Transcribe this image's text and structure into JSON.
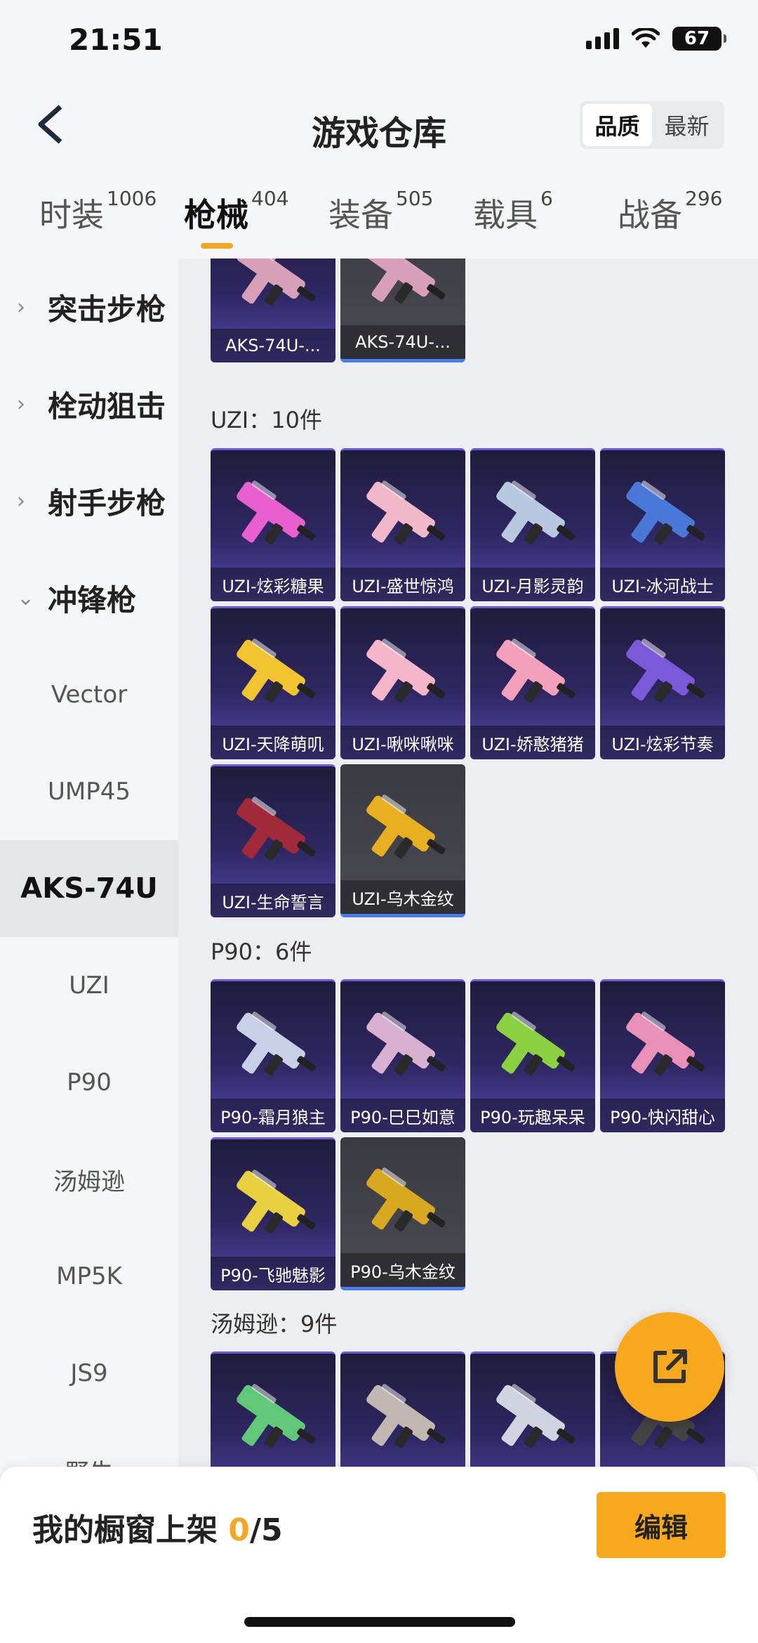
{
  "status_bar": {
    "time": "21:51",
    "battery": "67"
  },
  "header": {
    "title": "游戏仓库",
    "sort_options": [
      "品质",
      "最新"
    ],
    "active_sort": "品质"
  },
  "category_tabs": [
    {
      "label": "时装",
      "count": "1006"
    },
    {
      "label": "枪械",
      "count": "404",
      "active": true
    },
    {
      "label": "装备",
      "count": "505"
    },
    {
      "label": "载具",
      "count": "6"
    },
    {
      "label": "战备",
      "count": "296"
    }
  ],
  "sidebar": {
    "groups": [
      "突击步枪",
      "栓动狙击",
      "射手步枪",
      "冲锋枪"
    ],
    "items": [
      "Vector",
      "UMP45",
      "AKS-74U",
      "UZI",
      "P90",
      "汤姆逊",
      "MP5K",
      "JS9",
      "野牛"
    ],
    "active_item": "AKS-74U"
  },
  "sections": {
    "aks": {
      "cards": [
        {
          "label": "AKS-74U-...",
          "style": "purple"
        },
        {
          "label": "AKS-74U-...",
          "style": "gray"
        }
      ]
    },
    "uzi": {
      "title": "UZI：10件",
      "cards": [
        {
          "label": "UZI-炫彩糖果",
          "style": "purple",
          "color": "#e85fd0"
        },
        {
          "label": "UZI-盛世惊鸿",
          "style": "purple",
          "color": "#f0b8c8"
        },
        {
          "label": "UZI-月影灵韵",
          "style": "purple",
          "color": "#b8c8e0"
        },
        {
          "label": "UZI-冰河战士",
          "style": "purple",
          "color": "#4a78d8"
        },
        {
          "label": "UZI-天降萌叽",
          "style": "purple",
          "color": "#f2c430"
        },
        {
          "label": "UZI-啾咪啾咪",
          "style": "purple",
          "color": "#f4b6c8"
        },
        {
          "label": "UZI-娇憨猪猪",
          "style": "purple",
          "color": "#f2a0bc"
        },
        {
          "label": "UZI-炫彩节奏",
          "style": "purple",
          "color": "#7a5ad8"
        },
        {
          "label": "UZI-生命誓言",
          "style": "purple",
          "color": "#a02a3a"
        },
        {
          "label": "UZI-乌木金纹",
          "style": "gray",
          "color": "#e8b020"
        }
      ]
    },
    "p90": {
      "title": "P90：6件",
      "cards": [
        {
          "label": "P90-霜月狼主",
          "style": "purple",
          "color": "#c8d0e8"
        },
        {
          "label": "P90-巳巳如意",
          "style": "purple",
          "color": "#d8b0d0"
        },
        {
          "label": "P90-玩趣呆呆",
          "style": "purple",
          "color": "#8ad040"
        },
        {
          "label": "P90-快闪甜心",
          "style": "purple",
          "color": "#e890b8"
        },
        {
          "label": "P90-飞驰魅影",
          "style": "purple",
          "color": "#e8d040"
        },
        {
          "label": "P90-乌木金纹",
          "style": "gray",
          "color": "#d8a820"
        }
      ]
    },
    "thompson": {
      "title": "汤姆逊：9件",
      "cards": [
        {
          "label": "",
          "style": "purple",
          "color": "#60c878"
        },
        {
          "label": "",
          "style": "purple",
          "color": "#c0b8b0"
        },
        {
          "label": "",
          "style": "purple",
          "color": "#d0d4e0"
        },
        {
          "label": "",
          "style": "purple",
          "color": "#444"
        }
      ]
    }
  },
  "bottom_bar": {
    "label": "我的橱窗上架",
    "current": "0",
    "total": "/5",
    "edit_label": "编辑"
  },
  "colors": {
    "accent": "#f5a623",
    "card_purple": "#5546a8",
    "card_gray": "#4a4b52"
  }
}
